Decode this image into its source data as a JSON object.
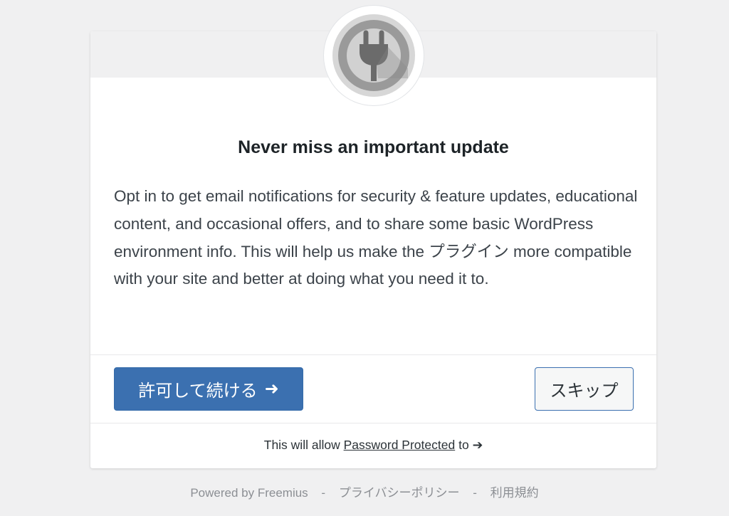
{
  "dialog": {
    "title": "Never miss an important update",
    "description": "Opt in to get email notifications for security & feature updates, educational content, and occasional offers, and to share some basic WordPress environment info. This will help us make the プラグイン more compatible with your site and better at doing what you need it to.",
    "icon": "plugin-plug-icon",
    "primary_button_label": "許可して続ける",
    "primary_button_arrow": "➜",
    "secondary_button_label": "スキップ",
    "permissions_prefix": "This will allow",
    "permissions_link": "Password Protected",
    "permissions_suffix": "to",
    "permissions_arrow": "➔"
  },
  "footer": {
    "powered_by": "Powered by Freemius",
    "separator": "-",
    "privacy_policy": "プライバシーポリシー",
    "terms": "利用規約"
  },
  "colors": {
    "background": "#f0f0f1",
    "primary": "#3b70b0",
    "icon_gray": "#a0a0a0",
    "icon_dark": "#6d6d6d"
  }
}
